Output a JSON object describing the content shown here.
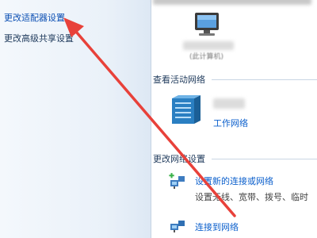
{
  "sidebar": {
    "links": [
      {
        "label": "更改适配器设置"
      },
      {
        "label": "更改高级共享设置"
      }
    ]
  },
  "header": {
    "computer_caption": "(此计算机)"
  },
  "active_networks": {
    "heading": "查看活动网络",
    "network_type": "工作网络"
  },
  "change_settings": {
    "heading": "更改网络设置",
    "items": [
      {
        "label": "设置新的连接或网络",
        "description": "设置无线、宽带、拨号、临时"
      },
      {
        "label": "连接到网络"
      }
    ]
  },
  "colors": {
    "annotation_arrow": "#e8413a",
    "link": "#0b5fcc",
    "server_icon": "#2a7fc2"
  },
  "icons": [
    "computer-icon",
    "server-icon",
    "network-setup-icon",
    "connect-network-icon",
    "arrow-annotation"
  ]
}
